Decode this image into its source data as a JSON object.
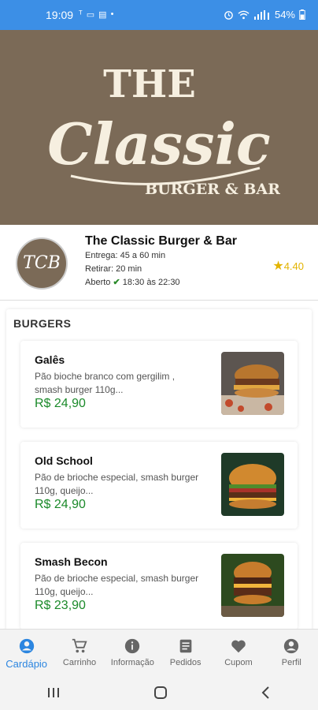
{
  "status_bar": {
    "time": "19:09",
    "left_icons": [
      "ᵀ",
      "▭",
      "▤",
      "•"
    ],
    "battery": "54%"
  },
  "banner": {
    "line1": "THE",
    "line2": "Classic",
    "line3": "BURGER & BAR"
  },
  "restaurant": {
    "logo_text": "TCB",
    "name": "The Classic Burger & Bar",
    "delivery": "Entrega: 45 a 60 min",
    "pickup": "Retirar: 20 min",
    "open_label": "Aberto",
    "hours": "18:30 às 22:30",
    "rating": "4.40"
  },
  "menu": {
    "section_title": "BURGERS",
    "items": [
      {
        "name": "Galês",
        "desc": "Pão bioche branco com gergilim , smash burger 110g...",
        "price": "R$ 24,90"
      },
      {
        "name": "Old School",
        "desc": "Pão de brioche especial, smash burger 110g, queijo...",
        "price": "R$ 24,90"
      },
      {
        "name": "Smash Becon",
        "desc": "Pão de brioche especial, smash burger 110g, queijo...",
        "price": "R$ 23,90"
      }
    ]
  },
  "bottom_nav": [
    {
      "label": "Cardápio",
      "icon": "account-circle-icon",
      "active": true
    },
    {
      "label": "Carrinho",
      "icon": "cart-icon",
      "active": false
    },
    {
      "label": "Informação",
      "icon": "info-icon",
      "active": false
    },
    {
      "label": "Pedidos",
      "icon": "receipt-icon",
      "active": false
    },
    {
      "label": "Cupom",
      "icon": "heart-icon",
      "active": false
    },
    {
      "label": "Perfil",
      "icon": "account-circle-icon",
      "active": false
    }
  ],
  "colors": {
    "status_bar": "#3c8fe6",
    "banner": "#7b6a57",
    "price": "#1b8a2a",
    "active_nav": "#2c86e0",
    "rating": "#e3b400"
  }
}
